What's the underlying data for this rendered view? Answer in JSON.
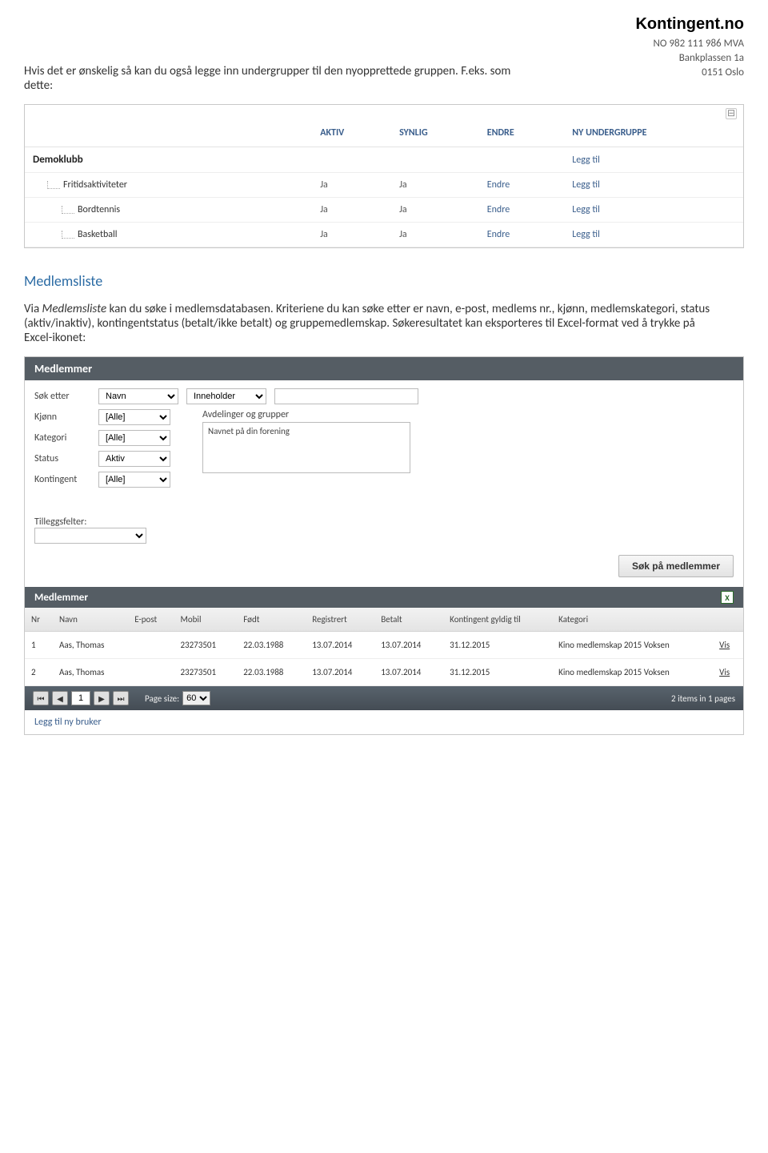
{
  "header": {
    "logo": "Kontingent.no",
    "vat": "NO 982 111 986 MVA",
    "addr1": "Bankplassen 1a",
    "addr2": "0151 Oslo"
  },
  "intro": "Hvis det er ønskelig så kan du også legge inn undergrupper til den nyopprettede gruppen. F.eks. som dette:",
  "groups": {
    "headers": {
      "aktiv": "AKTIV",
      "synlig": "SYNLIG",
      "endre": "ENDRE",
      "ny": "NY UNDERGRUPPE"
    },
    "club": "Demoklubb",
    "legg_til": "Legg til",
    "endre": "Endre",
    "rows": [
      {
        "name": "Fritidsaktiviteter",
        "aktiv": "Ja",
        "synlig": "Ja",
        "indent": 1
      },
      {
        "name": "Bordtennis",
        "aktiv": "Ja",
        "synlig": "Ja",
        "indent": 2
      },
      {
        "name": "Basketball",
        "aktiv": "Ja",
        "synlig": "Ja",
        "indent": 2
      }
    ]
  },
  "medlemsliste": {
    "title": "Medlemsliste",
    "body_1": "Via ",
    "body_em": "Medlemsliste",
    "body_2": " kan du søke i medlemsdatabasen. Kriteriene du kan søke etter er navn, e-post, medlems nr., kjønn, medlemskategori, status (aktiv/inaktiv), kontingentstatus (betalt/ikke betalt) og gruppemedlemskap. Søkeresultatet kan eksporteres til Excel-format ved å trykke på Excel-ikonet:"
  },
  "panel2": {
    "title": "Medlemmer",
    "sok_etter": "Søk etter",
    "field_type": "Navn",
    "match_type": "Inneholder",
    "kjonn_label": "Kjønn",
    "kjonn_val": "[Alle]",
    "kategori_label": "Kategori",
    "kategori_val": "[Alle]",
    "status_label": "Status",
    "status_val": "Aktiv",
    "kontingent_label": "Kontingent",
    "kontingent_val": "[Alle]",
    "avd_label": "Avdelinger og grupper",
    "avd_item": "Navnet på din forening",
    "tilleggs_label": "Tilleggsfelter:",
    "sok_btn": "Søk på medlemmer",
    "results_title": "Medlemmer"
  },
  "results": {
    "headers": {
      "nr": "Nr",
      "navn": "Navn",
      "epost": "E-post",
      "mobil": "Mobil",
      "fodt": "Født",
      "registrert": "Registrert",
      "betalt": "Betalt",
      "gyldig": "Kontingent gyldig til",
      "kategori": "Kategori"
    },
    "rows": [
      {
        "nr": "1",
        "navn": "Aas, Thomas",
        "epost": "",
        "mobil": "23273501",
        "fodt": "22.03.1988",
        "registrert": "13.07.2014",
        "betalt": "13.07.2014",
        "gyldig": "31.12.2015",
        "kategori": "Kino medlemskap 2015 Voksen",
        "vis": "Vis"
      },
      {
        "nr": "2",
        "navn": "Aas, Thomas",
        "epost": "",
        "mobil": "23273501",
        "fodt": "22.03.1988",
        "registrert": "13.07.2014",
        "betalt": "13.07.2014",
        "gyldig": "31.12.2015",
        "kategori": "Kino medlemskap 2015 Voksen",
        "vis": "Vis"
      }
    ],
    "pager": {
      "page": "1",
      "pagesize_label": "Page size:",
      "pagesize": "60",
      "summary": "2 items in 1 pages"
    },
    "add_user": "Legg til ny bruker"
  }
}
